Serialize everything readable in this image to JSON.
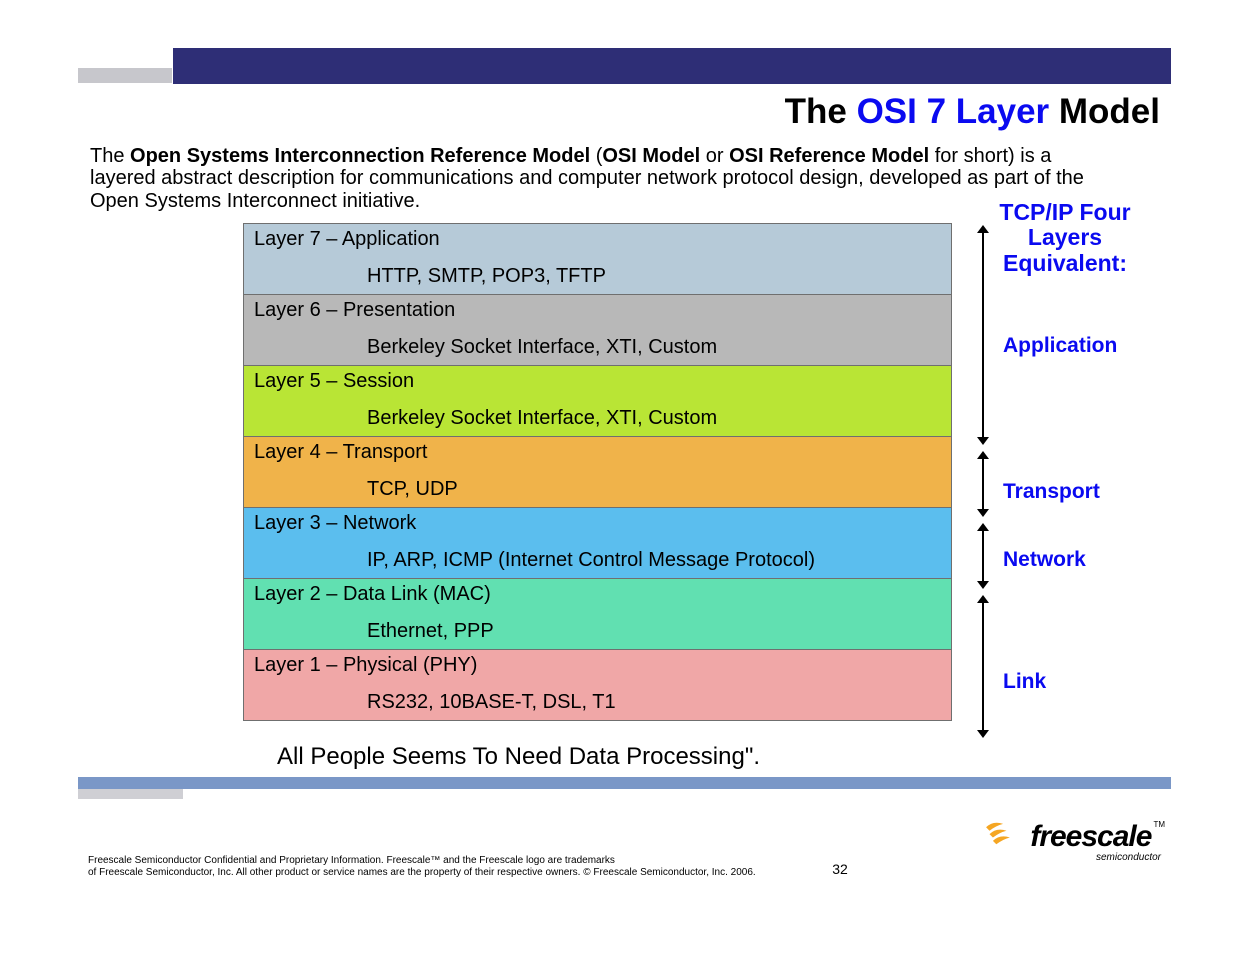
{
  "title": {
    "prefix": "The ",
    "highlight": "OSI 7 Layer",
    "suffix": " Model"
  },
  "intro": {
    "t1": "The ",
    "b1": "Open Systems Interconnection Reference Model",
    "t2": " (",
    "b2": "OSI Model",
    "t3": " or ",
    "b3": "OSI Reference Model",
    "t4": " for short) is a layered abstract description for communications and computer network protocol design, developed as part of the Open Systems Interconnect initiative."
  },
  "layers": [
    {
      "name": "Layer 7 – Application",
      "examples": "HTTP, SMTP, POP3, TFTP"
    },
    {
      "name": "Layer 6 – Presentation",
      "examples": "Berkeley Socket Interface, XTI, Custom"
    },
    {
      "name": "Layer 5 – Session",
      "examples": "Berkeley Socket Interface, XTI, Custom"
    },
    {
      "name": "Layer 4 – Transport",
      "examples": "TCP, UDP"
    },
    {
      "name": "Layer 3 – Network",
      "examples": "IP, ARP, ICMP (Internet Control Message Protocol)"
    },
    {
      "name": "Layer 2 – Data Link (MAC)",
      "examples": "Ethernet, PPP"
    },
    {
      "name": "Layer 1 – Physical (PHY)",
      "examples": "RS232, 10BASE-T, DSL, T1"
    }
  ],
  "mnemonic": "All People Seems To Need Data Processing\".",
  "tcpip": {
    "header_line1": "TCP/IP Four",
    "header_line2": "Layers",
    "header_line3": "Equivalent:",
    "labels": [
      "Application",
      "Transport",
      "Network",
      "Link"
    ]
  },
  "footer": {
    "legal_line1": "Freescale Semiconductor Confidential and Proprietary Information. Freescale™ and the Freescale logo are trademarks",
    "legal_line2": "of Freescale Semiconductor, Inc. All other product or service names are the property of their respective owners. © Freescale Semiconductor, Inc. 2006.",
    "page": "32"
  },
  "logo": {
    "name": "freescale",
    "sub": "semiconductor",
    "tm": "TM"
  }
}
